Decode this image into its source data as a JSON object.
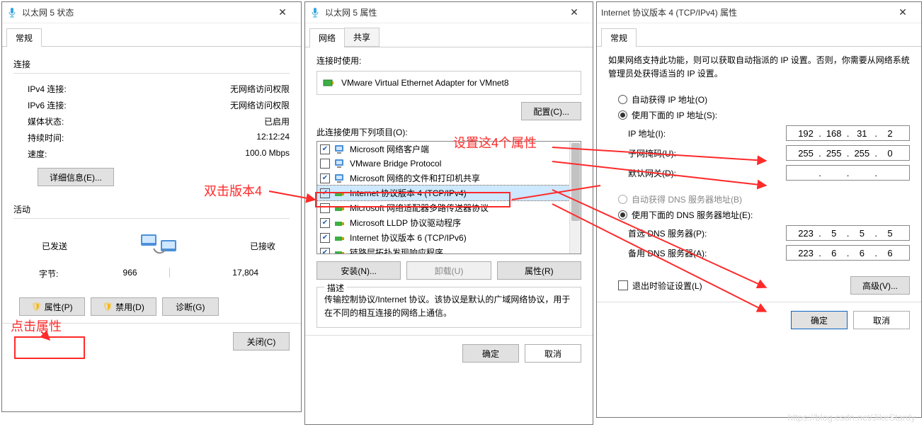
{
  "win_status": {
    "title": "以太网 5 状态",
    "tab_general": "常规",
    "section_connection": "连接",
    "ipv4_label": "IPv4 连接:",
    "ipv4_value": "无网络访问权限",
    "ipv6_label": "IPv6 连接:",
    "ipv6_value": "无网络访问权限",
    "media_label": "媒体状态:",
    "media_value": "已启用",
    "duration_label": "持续时间:",
    "duration_value": "12:12:24",
    "speed_label": "速度:",
    "speed_value": "100.0 Mbps",
    "details_btn": "详细信息(E)...",
    "section_activity": "活动",
    "sent_label": "已发送",
    "recv_label": "已接收",
    "bytes_label": "字节:",
    "bytes_sent": "966",
    "bytes_recv": "17,804",
    "props_btn": "属性(P)",
    "disable_btn": "禁用(D)",
    "diag_btn": "诊断(G)",
    "close_btn": "关闭(C)"
  },
  "win_props": {
    "title": "以太网 5 属性",
    "tab_network": "网络",
    "tab_share": "共享",
    "connect_using": "连接时使用:",
    "adapter": "VMware Virtual Ethernet Adapter for VMnet8",
    "configure_btn": "配置(C)...",
    "uses_label": "此连接使用下列项目(O):",
    "items": [
      {
        "checked": true,
        "icon": "net-client-icon",
        "label": "Microsoft 网络客户端"
      },
      {
        "checked": false,
        "icon": "net-client-icon",
        "label": "VMware Bridge Protocol"
      },
      {
        "checked": true,
        "icon": "net-client-icon",
        "label": "Microsoft 网络的文件和打印机共享"
      },
      {
        "checked": true,
        "icon": "protocol-icon",
        "label": "Internet 协议版本 4 (TCP/IPv4)"
      },
      {
        "checked": false,
        "icon": "protocol-icon",
        "label": "Microsoft 网络适配器多路传送器协议"
      },
      {
        "checked": true,
        "icon": "protocol-icon",
        "label": "Microsoft LLDP 协议驱动程序"
      },
      {
        "checked": true,
        "icon": "protocol-icon",
        "label": "Internet 协议版本 6 (TCP/IPv6)"
      },
      {
        "checked": true,
        "icon": "protocol-icon",
        "label": "链路层拓扑发现响应程序"
      }
    ],
    "install_btn": "安装(N)...",
    "uninstall_btn": "卸载(U)",
    "item_props_btn": "属性(R)",
    "desc_head": "描述",
    "desc_text": "传输控制协议/Internet 协议。该协议是默认的广域网络协议，用于在不同的相互连接的网络上通信。",
    "ok_btn": "确定",
    "cancel_btn": "取消"
  },
  "win_ipv4": {
    "title": "Internet 协议版本 4 (TCP/IPv4) 属性",
    "tab_general": "常规",
    "intro": "如果网络支持此功能，则可以获取自动指派的 IP 设置。否则，你需要从网络系统管理员处获得适当的 IP 设置。",
    "radio_auto_ip": "自动获得 IP 地址(O)",
    "radio_manual_ip": "使用下面的 IP 地址(S):",
    "ip_label": "IP 地址(I):",
    "ip_value": [
      "192",
      "168",
      "31",
      "2"
    ],
    "mask_label": "子网掩码(U):",
    "mask_value": [
      "255",
      "255",
      "255",
      "0"
    ],
    "gw_label": "默认网关(D):",
    "gw_value": [
      "",
      "",
      "",
      ""
    ],
    "radio_auto_dns": "自动获得 DNS 服务器地址(B)",
    "radio_manual_dns": "使用下面的 DNS 服务器地址(E):",
    "dns1_label": "首选 DNS 服务器(P):",
    "dns1_value": [
      "223",
      "5",
      "5",
      "5"
    ],
    "dns2_label": "备用 DNS 服务器(A):",
    "dns2_value": [
      "223",
      "6",
      "6",
      "6"
    ],
    "validate_chk": "退出时验证设置(L)",
    "advanced_btn": "高级(V)...",
    "ok_btn": "确定",
    "cancel_btn": "取消"
  },
  "annotations": {
    "note1": "点击属性",
    "note2": "双击版本4",
    "note3": "设置这4个属性"
  },
  "watermark": "https://blog.csdn.net/JikeStardy"
}
